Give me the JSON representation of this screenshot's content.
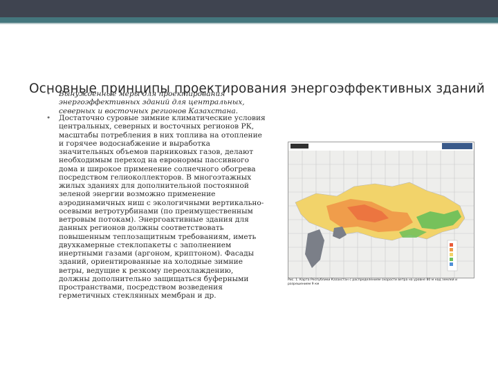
{
  "slide": {
    "title": "Основные принципы проектирования энергоэффективных зданий",
    "subtitle_bullet": "Вынужденные меры для проектирования энергоэффективных зданий для центральных, северных и восточных регионов Казахстана.",
    "body_bullet": "Достаточно суровые зимние климатические условия центральных, северных и восточных регионов РК, масштабы потребления в них топлива на  отопление и горячее водоснабжение и выработка значительных объемов парниковых газов, делают необходимым переход на евронормы пассивного дома и широкое применение солнечного обогрева посредством гелиоколлекторов. В многоэтажных жилых зданиях для дополнительной постоянной зеленой энергии возможно применение аэродинамичных ниш с экологичными вертикально-осевыми ветротурбинами (по преимущественным ветровым потокам). Энергоактивные здания для данных регионов должны соответствовать повышенным теплозащитным требованиям, иметь двухкамерные стеклопакеты с заполнением инертными газами (аргоном, криптоном). Фасады зданий, ориентированные на холодные зимние ветры, ведущие к резкому переохлаждению, должны дополнительно защищаться буферными пространствами, посредством возведения герметичных стеклянных мембран и др.",
    "bullet_glyph": "•"
  },
  "map": {
    "caption": "Рис. 1. Карта Республики Казахстан с распределением скорости ветра на уровне 80 м над землей и разрешением 9 км"
  },
  "colors": {
    "topbar": "#3f4450",
    "accent_stripe": "#44767d",
    "map_yellow": "#f2d36a",
    "map_orange": "#ef9a4a",
    "map_green": "#6fc05b"
  }
}
